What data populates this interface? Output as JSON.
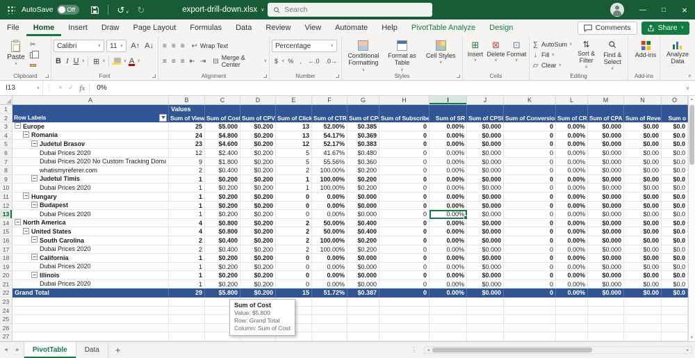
{
  "colors": {
    "titlebar_green": "#185C37",
    "accent_green": "#107C41",
    "pivot_blue": "#2F5597"
  },
  "titlebar": {
    "autosave_label": "AutoSave",
    "autosave_state": "Off",
    "filename": "export-drill-down.xlsx",
    "search_placeholder": "Search"
  },
  "ribbon_tabs": {
    "items": [
      "File",
      "Home",
      "Insert",
      "Draw",
      "Page Layout",
      "Formulas",
      "Data",
      "Review",
      "View",
      "Automate",
      "Help",
      "PivotTable Analyze",
      "Design"
    ],
    "active": "Home",
    "contextual": [
      "PivotTable Analyze",
      "Design"
    ],
    "comments_label": "Comments",
    "share_label": "Share"
  },
  "ribbon": {
    "clipboard": {
      "group_label": "Clipboard",
      "paste_label": "Paste"
    },
    "font": {
      "group_label": "Font",
      "font_name": "Calibri",
      "font_size": "11"
    },
    "alignment": {
      "group_label": "Alignment",
      "wrap_text_label": "Wrap Text",
      "merge_center_label": "Merge & Center"
    },
    "number": {
      "group_label": "Number",
      "format_value": "Percentage"
    },
    "styles": {
      "group_label": "Styles",
      "buttons": [
        "Conditional Formatting",
        "Format as Table",
        "Cell Styles"
      ]
    },
    "cells": {
      "group_label": "Cells",
      "buttons": [
        "Insert",
        "Delete",
        "Format"
      ]
    },
    "editing": {
      "group_label": "Editing",
      "autosum_label": "AutoSum",
      "fill_label": "Fill",
      "clear_label": "Clear",
      "sort_label": "Sort & Filter",
      "find_label": "Find & Select"
    },
    "addins": {
      "group_label": "Add-ins",
      "button": "Add-ins"
    },
    "analyze": {
      "button": "Analyze Data"
    }
  },
  "formula_bar": {
    "name_box": "I13",
    "fx_label": "fx",
    "value": "0%"
  },
  "grid": {
    "row_count": 27,
    "selected_cell": {
      "col": "I",
      "row": 13
    },
    "columns": [
      "A",
      "B",
      "C",
      "D",
      "E",
      "F",
      "G",
      "H",
      "I",
      "J",
      "K",
      "L",
      "M",
      "N",
      "O"
    ],
    "row1_label": "Values",
    "header_row": [
      "Row Labels",
      "Sum of Views",
      "Sum of Cost",
      "Sum of CPV",
      "Sum of Clicks",
      "Sum of CTR",
      "Sum of CPC",
      "Sum of Subscribers",
      "Sum of SR",
      "Sum of CPSUB",
      "Sum of Conversion",
      "Sum of CR",
      "Sum of CPA",
      "Sum of Revenue",
      "Sum o"
    ],
    "rows": [
      {
        "label": "Europe",
        "level": 0,
        "group": true,
        "values": [
          "25",
          "$5.000",
          "$0.200",
          "13",
          "52.00%",
          "$0.385",
          "0",
          "0.00%",
          "$0.000",
          "0",
          "0.00%",
          "$0.000",
          "$0.00",
          "$0.0"
        ]
      },
      {
        "label": "Romania",
        "level": 1,
        "group": true,
        "values": [
          "24",
          "$4.800",
          "$0.200",
          "13",
          "54.17%",
          "$0.369",
          "0",
          "0.00%",
          "$0.000",
          "0",
          "0.00%",
          "$0.000",
          "$0.00",
          "$0.0"
        ]
      },
      {
        "label": "Judetul Brasov",
        "level": 2,
        "group": true,
        "values": [
          "23",
          "$4.600",
          "$0.200",
          "12",
          "52.17%",
          "$0.383",
          "0",
          "0.00%",
          "$0.000",
          "0",
          "0.00%",
          "$0.000",
          "$0.00",
          "$0.0"
        ]
      },
      {
        "label": "Dubai Prices 2020",
        "level": 3,
        "group": false,
        "values": [
          "12",
          "$2.400",
          "$0.200",
          "5",
          "41.67%",
          "$0.480",
          "0",
          "0.00%",
          "$0.000",
          "0",
          "0.00%",
          "$0.000",
          "$0.00",
          "$0.0"
        ]
      },
      {
        "label": "Dubai Prices 2020 No Custom Tracking Domai",
        "level": 3,
        "group": false,
        "values": [
          "9",
          "$1.800",
          "$0.200",
          "5",
          "55.56%",
          "$0.360",
          "0",
          "0.00%",
          "$0.000",
          "0",
          "0.00%",
          "$0.000",
          "$0.00",
          "$0.0"
        ]
      },
      {
        "label": "whatismyreferer.com",
        "level": 3,
        "group": false,
        "values": [
          "2",
          "$0.400",
          "$0.200",
          "2",
          "100.00%",
          "$0.200",
          "0",
          "0.00%",
          "$0.000",
          "0",
          "0.00%",
          "$0.000",
          "$0.00",
          "$0.0"
        ]
      },
      {
        "label": "Judetul Timis",
        "level": 2,
        "group": true,
        "values": [
          "1",
          "$0.200",
          "$0.200",
          "1",
          "100.00%",
          "$0.200",
          "0",
          "0.00%",
          "$0.000",
          "0",
          "0.00%",
          "$0.000",
          "$0.00",
          "$0.0"
        ]
      },
      {
        "label": "Dubai Prices 2020",
        "level": 3,
        "group": false,
        "values": [
          "1",
          "$0.200",
          "$0.200",
          "1",
          "100.00%",
          "$0.200",
          "0",
          "0.00%",
          "$0.000",
          "0",
          "0.00%",
          "$0.000",
          "$0.00",
          "$0.0"
        ]
      },
      {
        "label": "Hungary",
        "level": 1,
        "group": true,
        "values": [
          "1",
          "$0.200",
          "$0.200",
          "0",
          "0.00%",
          "$0.000",
          "0",
          "0.00%",
          "$0.000",
          "0",
          "0.00%",
          "$0.000",
          "$0.00",
          "$0.0"
        ]
      },
      {
        "label": "Budapest",
        "level": 2,
        "group": true,
        "values": [
          "1",
          "$0.200",
          "$0.200",
          "0",
          "0.00%",
          "$0.000",
          "0",
          "0.00%",
          "$0.000",
          "0",
          "0.00%",
          "$0.000",
          "$0.00",
          "$0.0"
        ]
      },
      {
        "label": "Dubai Prices 2020",
        "level": 3,
        "group": false,
        "values": [
          "1",
          "$0.200",
          "$0.200",
          "0",
          "0.00%",
          "$0.000",
          "0",
          "0.00%",
          "$0.000",
          "0",
          "0.00%",
          "$0.000",
          "$0.00",
          "$0.0"
        ]
      },
      {
        "label": "North America",
        "level": 0,
        "group": true,
        "values": [
          "4",
          "$0.800",
          "$0.200",
          "2",
          "50.00%",
          "$0.400",
          "0",
          "0.00%",
          "$0.000",
          "0",
          "0.00%",
          "$0.000",
          "$0.00",
          "$0.0"
        ]
      },
      {
        "label": "United States",
        "level": 1,
        "group": true,
        "values": [
          "4",
          "$0.800",
          "$0.200",
          "2",
          "50.00%",
          "$0.400",
          "0",
          "0.00%",
          "$0.000",
          "0",
          "0.00%",
          "$0.000",
          "$0.00",
          "$0.0"
        ]
      },
      {
        "label": "South Carolina",
        "level": 2,
        "group": true,
        "values": [
          "2",
          "$0.400",
          "$0.200",
          "2",
          "100.00%",
          "$0.200",
          "0",
          "0.00%",
          "$0.000",
          "0",
          "0.00%",
          "$0.000",
          "$0.00",
          "$0.0"
        ]
      },
      {
        "label": "Dubai Prices 2020",
        "level": 3,
        "group": false,
        "values": [
          "2",
          "$0.400",
          "$0.200",
          "2",
          "100.00%",
          "$0.200",
          "0",
          "0.00%",
          "$0.000",
          "0",
          "0.00%",
          "$0.000",
          "$0.00",
          "$0.0"
        ]
      },
      {
        "label": "California",
        "level": 2,
        "group": true,
        "values": [
          "1",
          "$0.200",
          "$0.200",
          "0",
          "0.00%",
          "$0.000",
          "0",
          "0.00%",
          "$0.000",
          "0",
          "0.00%",
          "$0.000",
          "$0.00",
          "$0.0"
        ]
      },
      {
        "label": "Dubai Prices 2020",
        "level": 3,
        "group": false,
        "values": [
          "1",
          "$0.200",
          "$0.200",
          "0",
          "0.00%",
          "$0.000",
          "0",
          "0.00%",
          "$0.000",
          "0",
          "0.00%",
          "$0.000",
          "$0.00",
          "$0.0"
        ]
      },
      {
        "label": "Illinois",
        "level": 2,
        "group": true,
        "values": [
          "1",
          "$0.200",
          "$0.200",
          "0",
          "0.00%",
          "$0.000",
          "0",
          "0.00%",
          "$0.000",
          "0",
          "0.00%",
          "$0.000",
          "$0.00",
          "$0.0"
        ]
      },
      {
        "label": "Dubai Prices 2020",
        "level": 3,
        "group": false,
        "values": [
          "1",
          "$0.200",
          "$0.200",
          "0",
          "0.00%",
          "$0.000",
          "0",
          "0.00%",
          "$0.000",
          "0",
          "0.00%",
          "$0.000",
          "$0.00",
          "$0.0"
        ]
      }
    ],
    "grand_total": {
      "label": "Grand Total",
      "values": [
        "29",
        "$5.800",
        "$0.200",
        "15",
        "51.72%",
        "$0.387",
        "0",
        "0.00%",
        "$0.000",
        "0",
        "0.00%",
        "$0.000",
        "$0.00",
        "$0.0"
      ]
    }
  },
  "tooltip": {
    "title": "Sum of Cost",
    "lines": [
      "Value: $5.800",
      "Row: Grand Total",
      "Column: Sum of Cost"
    ]
  },
  "sheet_bar": {
    "tabs": [
      {
        "label": "PivotTable",
        "active": true
      },
      {
        "label": "Data",
        "active": false
      }
    ]
  }
}
